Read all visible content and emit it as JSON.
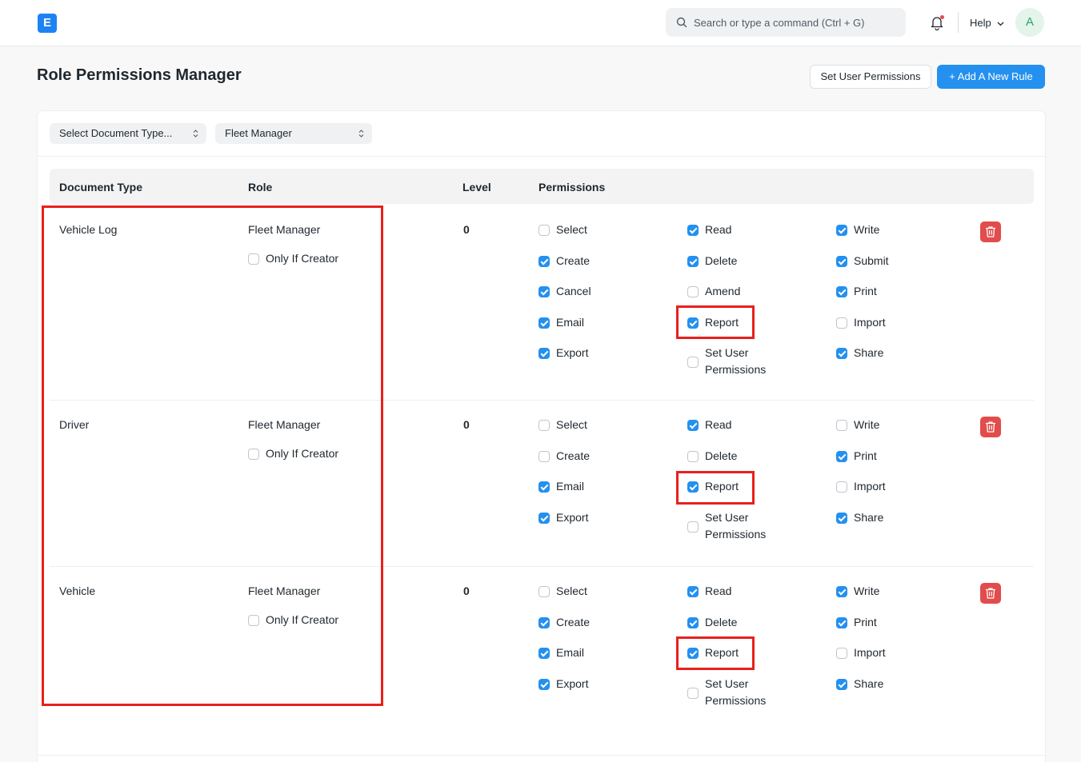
{
  "navbar": {
    "logo_letter": "E",
    "search_placeholder": "Search or type a command (Ctrl + G)",
    "help_label": "Help",
    "avatar_letter": "A"
  },
  "page": {
    "title": "Role Permissions Manager",
    "set_user_permissions_label": "Set User Permissions",
    "add_rule_label": "+ Add A New Rule"
  },
  "filters": {
    "doctype": "Select Document Type...",
    "role": "Fleet Manager"
  },
  "table": {
    "headers": [
      "Document Type",
      "Role",
      "Level",
      "Permissions"
    ]
  },
  "rules": [
    {
      "document_type": "Vehicle Log",
      "role": "Fleet Manager",
      "only_if_creator_label": "Only If Creator",
      "only_if_creator": false,
      "level": "0",
      "permissions": [
        [
          {
            "label": "Select",
            "checked": false
          },
          {
            "label": "Read",
            "checked": true
          },
          {
            "label": "Write",
            "checked": true
          }
        ],
        [
          {
            "label": "Create",
            "checked": true
          },
          {
            "label": "Delete",
            "checked": true
          },
          {
            "label": "Submit",
            "checked": true
          }
        ],
        [
          {
            "label": "Cancel",
            "checked": true
          },
          {
            "label": "Amend",
            "checked": false
          },
          {
            "label": "Print",
            "checked": true
          }
        ],
        [
          {
            "label": "Email",
            "checked": true
          },
          {
            "label": "Report",
            "checked": true
          },
          {
            "label": "Import",
            "checked": false
          }
        ],
        [
          {
            "label": "Export",
            "checked": true
          },
          {
            "label": "Set User Permissions",
            "checked": false
          },
          {
            "label": "Share",
            "checked": true
          }
        ]
      ]
    },
    {
      "document_type": "Driver",
      "role": "Fleet Manager",
      "only_if_creator_label": "Only If Creator",
      "only_if_creator": false,
      "level": "0",
      "permissions": [
        [
          {
            "label": "Select",
            "checked": false
          },
          {
            "label": "Read",
            "checked": true
          },
          {
            "label": "Write",
            "checked": false
          }
        ],
        [
          {
            "label": "Create",
            "checked": false
          },
          {
            "label": "Delete",
            "checked": false
          },
          {
            "label": "Print",
            "checked": true
          }
        ],
        [
          {
            "label": "Email",
            "checked": true
          },
          {
            "label": "Report",
            "checked": true
          },
          {
            "label": "Import",
            "checked": false
          }
        ],
        [
          {
            "label": "Export",
            "checked": true
          },
          {
            "label": "Set User Permissions",
            "checked": false
          },
          {
            "label": "Share",
            "checked": true
          }
        ]
      ]
    },
    {
      "document_type": "Vehicle",
      "role": "Fleet Manager",
      "only_if_creator_label": "Only If Creator",
      "only_if_creator": false,
      "level": "0",
      "permissions": [
        [
          {
            "label": "Select",
            "checked": false
          },
          {
            "label": "Read",
            "checked": true
          },
          {
            "label": "Write",
            "checked": true
          }
        ],
        [
          {
            "label": "Create",
            "checked": true
          },
          {
            "label": "Delete",
            "checked": true
          },
          {
            "label": "Print",
            "checked": true
          }
        ],
        [
          {
            "label": "Email",
            "checked": true
          },
          {
            "label": "Report",
            "checked": true
          },
          {
            "label": "Import",
            "checked": false
          }
        ],
        [
          {
            "label": "Export",
            "checked": true
          },
          {
            "label": "Set User Permissions",
            "checked": false
          },
          {
            "label": "Share",
            "checked": true
          }
        ]
      ]
    }
  ],
  "colors": {
    "primary": "#2490ef",
    "danger": "#e24c4c",
    "highlight": "#e8201c"
  },
  "icons": {
    "search": "search-icon",
    "bell": "bell-icon",
    "delete": "trash-icon",
    "sort": "sort-icon"
  }
}
